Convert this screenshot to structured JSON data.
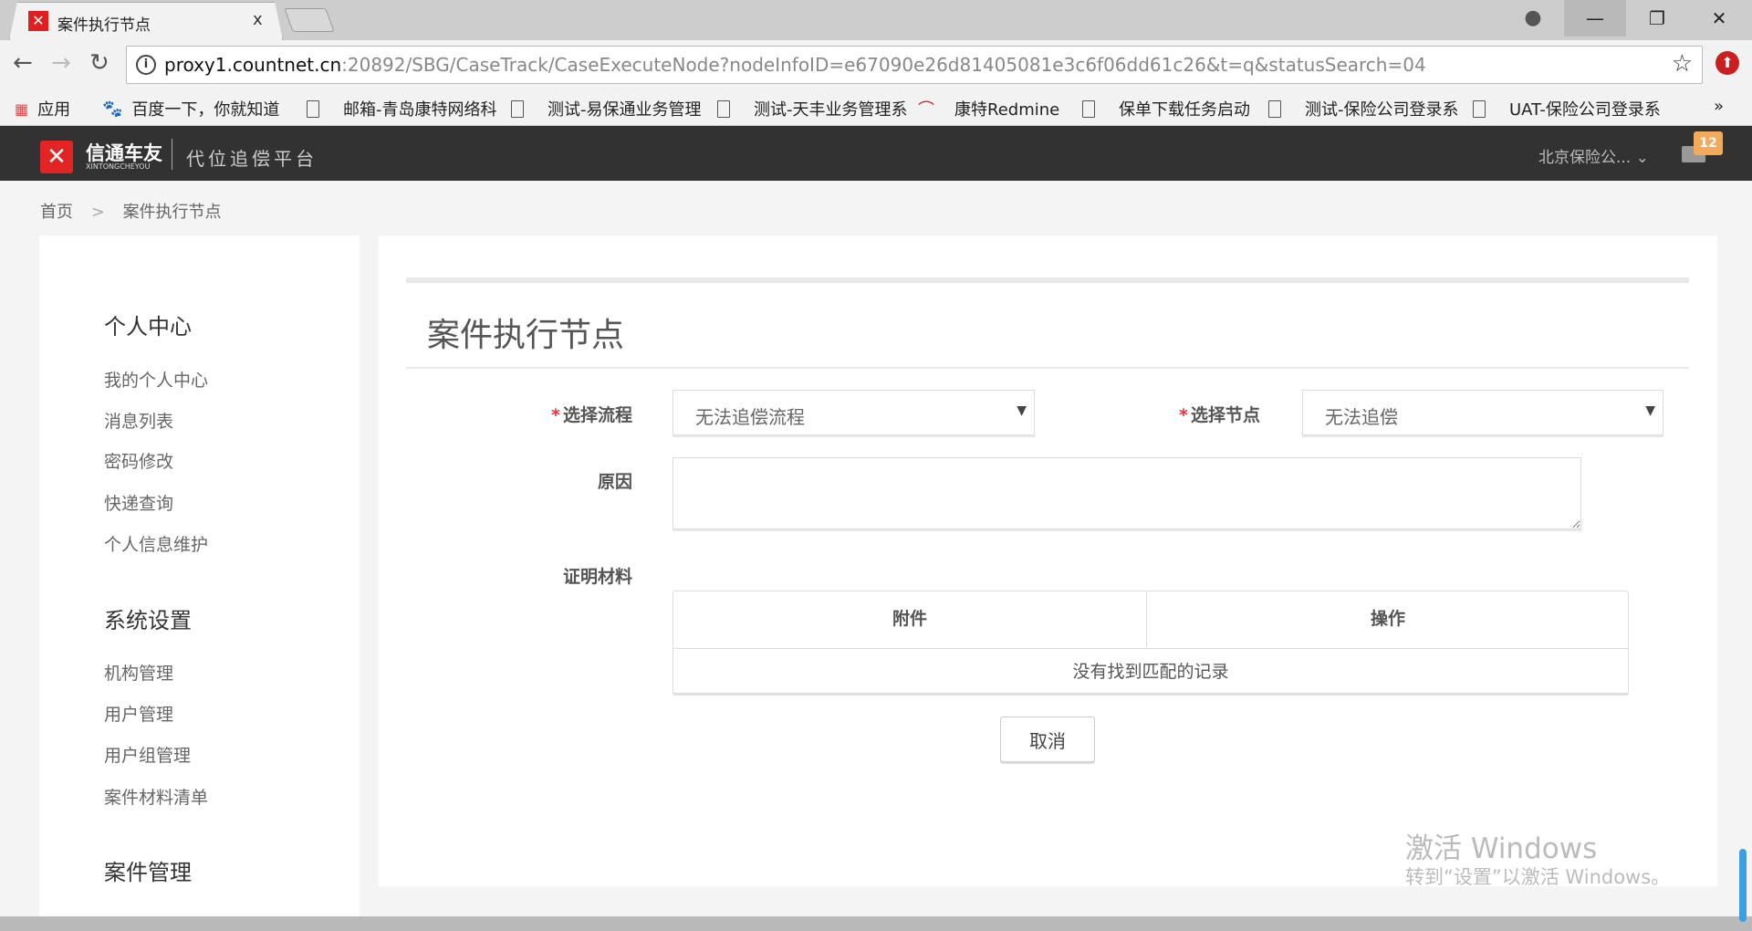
{
  "browser": {
    "tab_title": "案件执行节点",
    "tab_close": "x",
    "url_host": "proxy1.countnet.cn",
    "url_rest": ":20892/SBG/CaseTrack/CaseExecuteNode?nodeInfoID=e67090e26d81405081e3c6f06dd61c26&t=q&statusSearch=04",
    "bookmarks": [
      "应用",
      "百度一下，你就知道",
      "邮箱-青岛康特网络科",
      "测试-易保通业务管理",
      "测试-天丰业务管理系",
      "康特Redmine",
      "保单下载任务启动",
      "测试-保险公司登录系",
      "UAT-保险公司登录系"
    ],
    "more": "»"
  },
  "header": {
    "brand": "信通车友",
    "brand_sub": "XINTONGCHEYOU",
    "slogan": "代位追偿平台",
    "org": "北京保险公...",
    "mail_count": "12"
  },
  "breadcrumb": {
    "home": "首页",
    "sep": ">",
    "current": "案件执行节点"
  },
  "sidebar": {
    "groups": [
      {
        "title": "个人中心",
        "items": [
          "我的个人中心",
          "消息列表",
          "密码修改",
          "快递查询",
          "个人信息维护"
        ]
      },
      {
        "title": "系统设置",
        "items": [
          "机构管理",
          "用户管理",
          "用户组管理",
          "案件材料清单"
        ]
      },
      {
        "title": "案件管理",
        "items": []
      }
    ]
  },
  "main": {
    "title": "案件执行节点",
    "form": {
      "flow_label": "选择流程",
      "flow_value": "无法追偿流程",
      "node_label": "选择节点",
      "node_value": "无法追偿",
      "reason_label": "原因",
      "reason_value": "",
      "proof_label": "证明材料",
      "table_headers": [
        "附件",
        "操作"
      ],
      "empty_text": "没有找到匹配的记录",
      "cancel": "取消",
      "required_mark": "*"
    }
  },
  "watermark": {
    "line1": "激活 Windows",
    "line2": "转到“设置”以激活 Windows。"
  }
}
